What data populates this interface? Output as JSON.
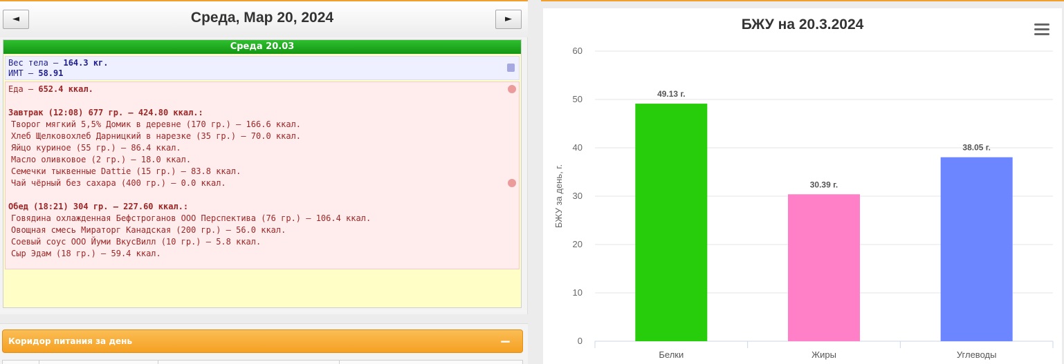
{
  "nav": {
    "date_title": "Среда, Мар 20, 2024",
    "prev_label": "◄",
    "next_label": "►"
  },
  "day": {
    "header": "Среда 20.03",
    "weight": {
      "label": "Вес тела — ",
      "value": "164.3 кг."
    },
    "bmi": {
      "label": "ИМТ — ",
      "value": "58.91"
    },
    "food_total": {
      "label": "Еда — ",
      "value": "652.4 ккал."
    },
    "meals": [
      {
        "title": "Завтрак (12:08) 677 гр. — 424.80 ккал.:",
        "items": [
          "Творог мягкий 5,5% Домик в деревне (170 гр.) — 166.6 ккал.",
          "Хлеб Щелковохлеб Дарницкий в нарезке (35 гр.) — 70.0 ккал.",
          "Яйцо куриное (55 гр.) — 86.4 ккал.",
          "Масло оливковое (2 гр.) — 18.0 ккал.",
          "Семечки тыквенные Dattie (15 гр.) — 83.8 ккал.",
          "Чай чёрный без сахара (400 гр.) — 0.0 ккал."
        ]
      },
      {
        "title": "Обед (18:21) 304 гр. — 227.60 ккал.:",
        "items": [
          "Говядина охлажденная Бефстроганов ООО Перспектива (76 гр.) — 106.4 ккал.",
          "Овощная смесь Мираторг Канадская (200 гр.) — 56.0 ккал.",
          "Соевый соус ООО Йуми ВкусВилл (10 гр.) — 5.8 ккал.",
          "Сыр Эдам (18 гр.) — 59.4 ккал."
        ]
      }
    ]
  },
  "corridor": {
    "title": "Коридор питания за день",
    "toggle": "−"
  },
  "chart_data": {
    "type": "bar",
    "title": "БЖУ на 20.3.2024",
    "ylabel": "БЖУ за день, г.",
    "xlabel": "",
    "categories": [
      "Белки",
      "Жиры",
      "Углеводы"
    ],
    "values": [
      49.13,
      30.39,
      38.05
    ],
    "data_labels": [
      "49.13 г.",
      "30.39 г.",
      "38.05 г."
    ],
    "colors": [
      "#27cc0a",
      "#ff80c6",
      "#6b86ff"
    ],
    "ylim": [
      0,
      60
    ],
    "yticks": [
      0,
      10,
      20,
      30,
      40,
      50,
      60
    ],
    "grid": true
  }
}
